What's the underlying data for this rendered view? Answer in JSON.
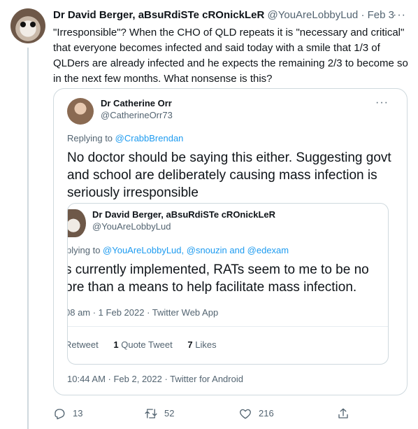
{
  "tweet": {
    "author_name": "Dr David Berger, aBsuRdiSTe cROnickLeR",
    "author_handle": "@YouAreLobbyLud",
    "time": "Feb 3",
    "text": "\"Irresponsible\"? When the CHO of QLD repeats it is \"necessary and critical\" that everyone becomes infected and said today with a smile that 1/3 of QLDers are already infected and he expects the remaining 2/3 to become so in the next few months. What nonsense is this?",
    "more": "···"
  },
  "quoted": {
    "author_name": "Dr Catherine Orr",
    "author_handle": "@CatherineOrr73",
    "replying_prefix": "Replying to ",
    "replying_to": "@CrabbBrendan",
    "text": "No doctor should be saying this either. Suggesting govt and school are deliberately causing mass infection is seriously irresponsible",
    "timestamp": "10:44 AM · Feb 2, 2022 · Twitter for Android",
    "more": "···",
    "nested": {
      "author_name": "Dr David Berger, aBsuRdiSTe cROnickLeR",
      "author_handle": "@YouAreLobbyLud",
      "replying_prefix": "plying to ",
      "replying_to": "@YouAreLobbyLud, @snouzin and @edexam",
      "text": "s currently implemented, RATs seem to me to be no\nore than a means to help facilitate mass infection.",
      "timestamp": "08 am · 1 Feb 2022 · Twitter Web App",
      "retweets_label": "Retweet",
      "quote_count": "1",
      "quote_label": "Quote Tweet",
      "likes_count": "7",
      "likes_label": "Likes"
    }
  },
  "actions": {
    "replies": "13",
    "retweets": "52",
    "likes": "216",
    "icons": [
      "reply-icon",
      "retweet-icon",
      "like-icon",
      "share-icon"
    ]
  },
  "colors": {
    "link": "#1d9bf0",
    "secondary_text": "#536471",
    "border": "#cfd9de"
  }
}
